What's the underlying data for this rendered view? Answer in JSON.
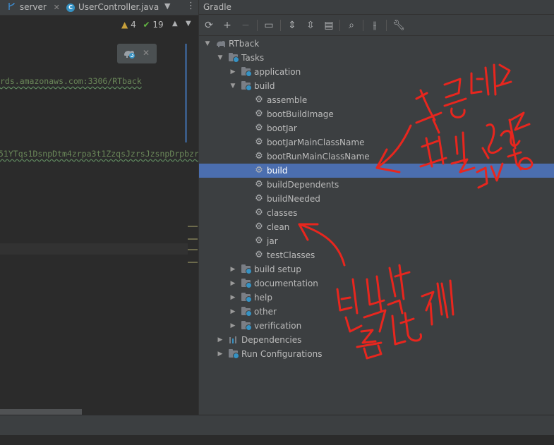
{
  "editor": {
    "tabs": [
      {
        "label": "server"
      },
      {
        "label": "UserController.java"
      }
    ],
    "inspections": {
      "warnings": "4",
      "typos": "19"
    },
    "code_lines": [
      "rds.amazonaws.com:3306/RTback",
      "51YTqs1DsnpDtm4zrpa3t1ZzqsJzrsJzsnpDrpbzr"
    ]
  },
  "gradle": {
    "title": "Gradle",
    "toolbar": [
      "reload-icon",
      "plus-icon",
      "minus-icon",
      "execute-task-icon",
      "expand-all-icon",
      "collapse-all-icon",
      "group-tasks-icon",
      "analyze-dependencies-icon",
      "toggle-offline-icon",
      "settings-wrench-icon"
    ],
    "tree": {
      "root": "RTback",
      "tasks": "Tasks",
      "groups": {
        "application": "application",
        "build": "build",
        "build_setup": "build setup",
        "documentation": "documentation",
        "help": "help",
        "other": "other",
        "verification": "verification"
      },
      "build_tasks": [
        "assemble",
        "bootBuildImage",
        "bootJar",
        "bootJarMainClassName",
        "bootRunMainClassName",
        "build",
        "buildDependents",
        "buildNeeded",
        "classes",
        "clean",
        "jar",
        "testClasses"
      ],
      "selected_task": "build",
      "dependencies": "Dependencies",
      "run_configurations": "Run Configurations"
    }
  },
  "annotations": {
    "top_right_handwritten": "최종배포 파일 jar 생성",
    "bottom_handwritten": "빌드전 클린하기",
    "color": "#e8261e"
  },
  "colors": {
    "selection": "#4b6eaf",
    "panel_bg": "#3c3f41",
    "editor_bg": "#2b2b2b",
    "string_green": "#6a8759"
  }
}
